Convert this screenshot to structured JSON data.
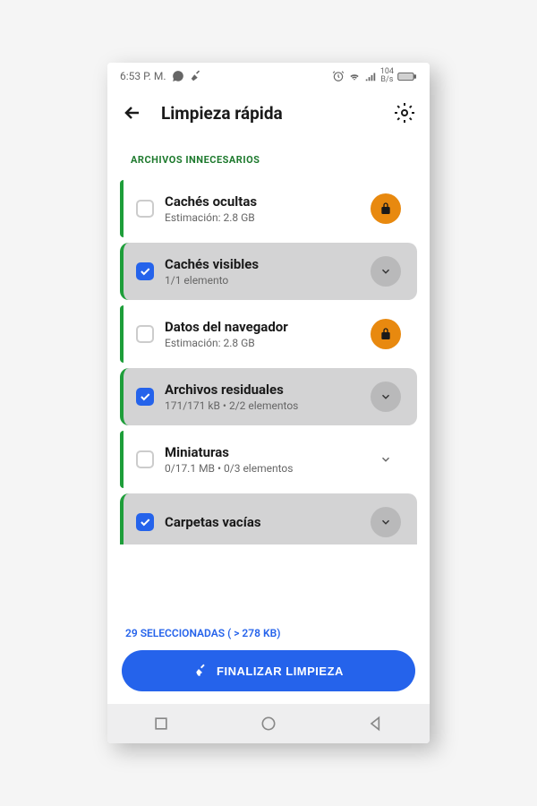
{
  "status_bar": {
    "time": "6:53 P. M.",
    "speed_label": "104",
    "speed_unit": "B/s"
  },
  "header": {
    "title": "Limpieza rápida"
  },
  "section": {
    "label": "ARCHIVOS INNECESARIOS"
  },
  "items": [
    {
      "title": "Cachés ocultas",
      "subtitle": "Estimación: 2.8 GB",
      "checked": false,
      "action": "lock"
    },
    {
      "title": "Cachés visibles",
      "subtitle": "1/1 elemento",
      "checked": true,
      "action": "expand"
    },
    {
      "title": "Datos del navegador",
      "subtitle": "Estimación: 2.8 GB",
      "checked": false,
      "action": "lock"
    },
    {
      "title": "Archivos residuales",
      "subtitle": "171/171 kB • 2/2 elementos",
      "checked": true,
      "action": "expand"
    },
    {
      "title": "Miniaturas",
      "subtitle": "0/17.1 MB • 0/3 elementos",
      "checked": false,
      "action": "expand-light"
    },
    {
      "title": "Carpetas vacías",
      "subtitle": "",
      "checked": true,
      "action": "expand"
    }
  ],
  "footer": {
    "selection_text": "29 SELECCIONADAS ( > 278 KB)",
    "button_label": "FINALIZAR LIMPIEZA"
  }
}
